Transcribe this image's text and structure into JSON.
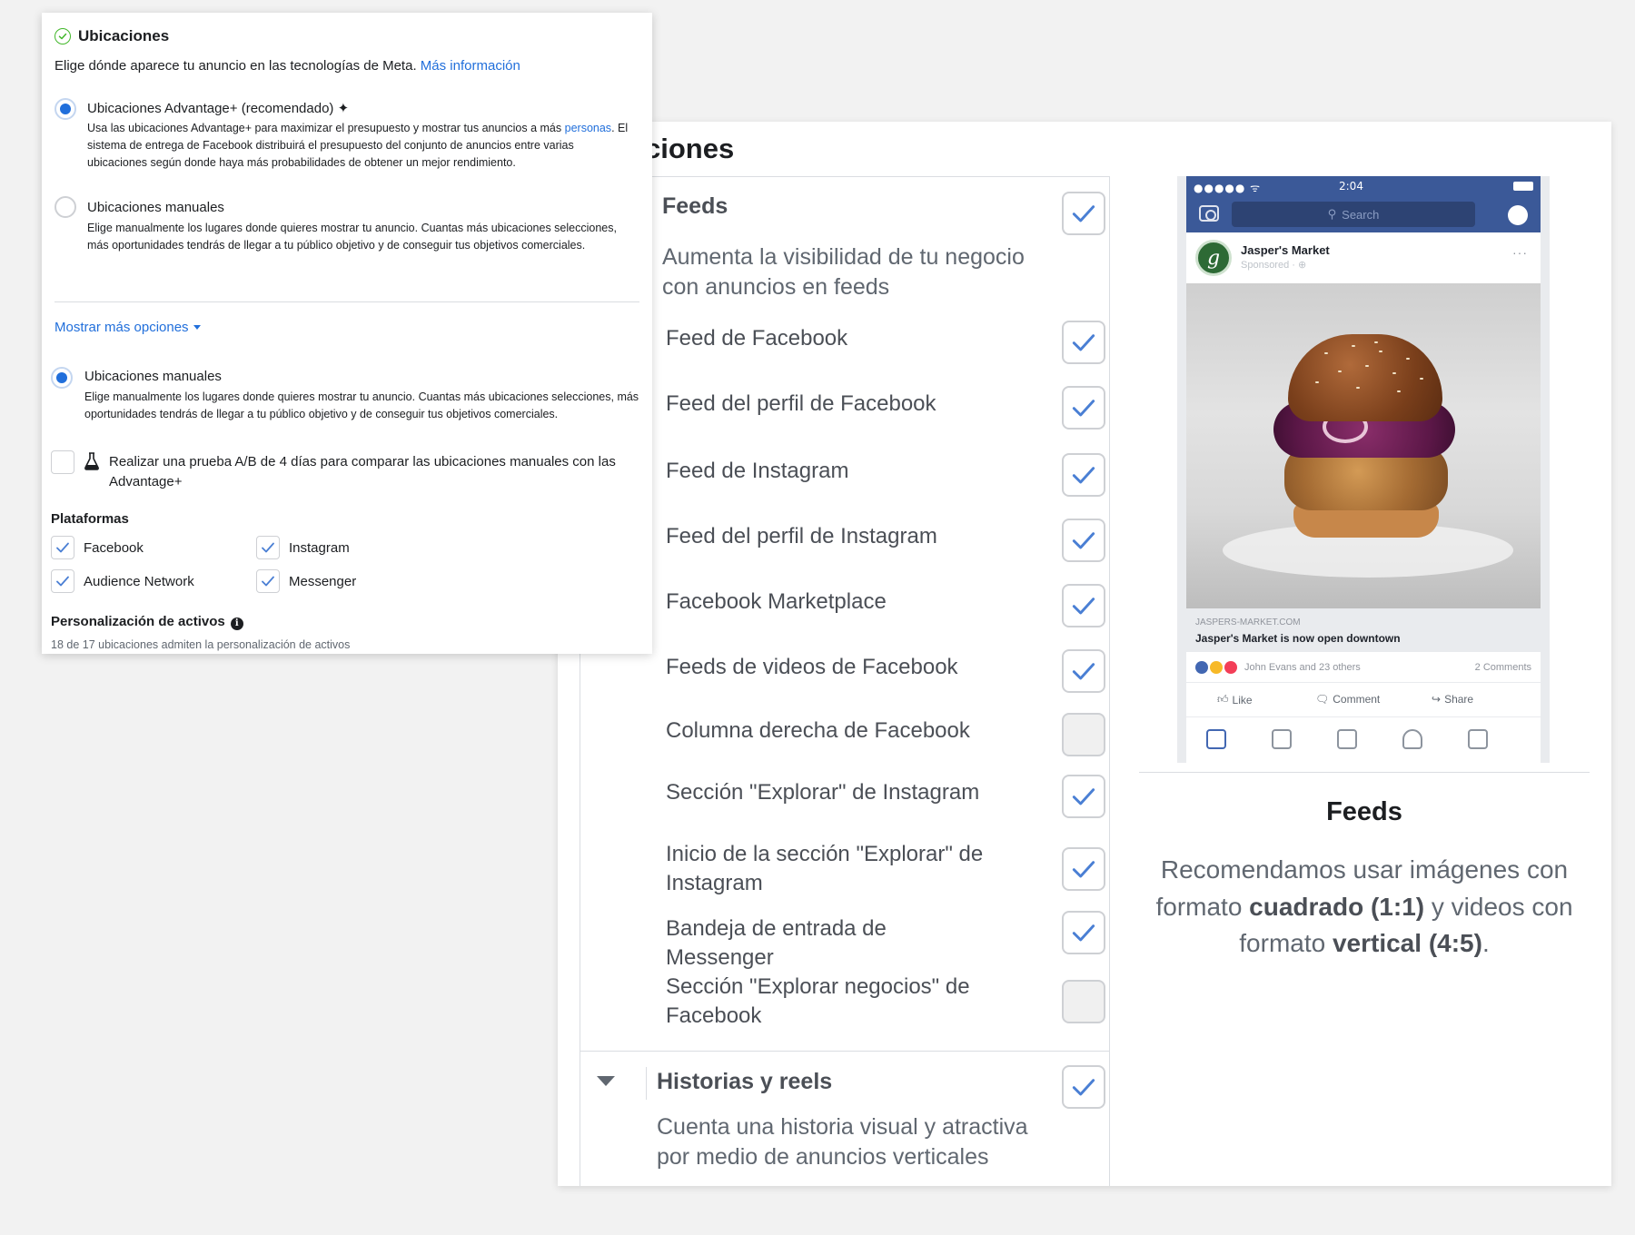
{
  "card": {
    "title": "Ubicaciones",
    "subtitle": "Elige dónde aparece tu anuncio en las tecnologías de Meta.",
    "subtitle_link": "Más información",
    "option_advantage": {
      "title": "Ubicaciones Advantage+ (recomendado)",
      "sparkle": "✦",
      "desc_pre": "Usa las ubicaciones Advantage+ para maximizar el presupuesto y mostrar tus anuncios a más",
      "desc_link": "personas",
      "desc_post": ". El sistema de entrega de Facebook distribuirá el presupuesto del conjunto de anuncios entre varias ubicaciones según donde haya más probabilidades de obtener un mejor rendimiento."
    },
    "option_manual": {
      "title": "Ubicaciones manuales",
      "desc": "Elige manualmente los lugares donde quieres mostrar tu anuncio. Cuantas más ubicaciones selecciones, más oportunidades tendrás de llegar a tu público objetivo y de conseguir tus objetivos comerciales."
    },
    "show_more": "Mostrar más opciones",
    "option_manual_selected": {
      "title": "Ubicaciones manuales",
      "desc": "Elige manualmente los lugares donde quieres mostrar tu anuncio. Cuantas más ubicaciones selecciones, más oportunidades tendrás de llegar a tu público objetivo y de conseguir tus objetivos comerciales."
    },
    "ab_test": "Realizar una prueba A/B de 4 días para comparar las ubicaciones manuales con las Advantage+",
    "platforms_title": "Plataformas",
    "platforms": [
      "Facebook",
      "Instagram",
      "Audience Network",
      "Messenger"
    ],
    "asset_title": "Personalización de activos",
    "asset_info": "i",
    "asset_note": "18 de 17 ubicaciones admiten la personalización de activos"
  },
  "bg": {
    "title": "ciones",
    "feeds": {
      "name": "Feeds",
      "desc": "Aumenta la visibilidad de tu negocio con anuncios en feeds",
      "checked": true
    },
    "items": [
      {
        "label": "Feed de Facebook",
        "checked": true
      },
      {
        "label": "Feed del perfil de Facebook",
        "checked": true
      },
      {
        "label": "Feed de Instagram",
        "checked": true
      },
      {
        "label": "Feed del perfil de Instagram",
        "checked": true
      },
      {
        "label": "Facebook Marketplace",
        "checked": true
      },
      {
        "label": "Feeds de videos de Facebook",
        "checked": true
      },
      {
        "label": "Columna derecha de Facebook",
        "checked": false
      },
      {
        "label": "Sección \"Explorar\" de Instagram",
        "checked": true
      },
      {
        "label": "Inicio de la sección \"Explorar\" de Instagram",
        "checked": true
      },
      {
        "label": "Bandeja de entrada de Messenger",
        "checked": true
      },
      {
        "label": "Sección \"Explorar negocios\" de Facebook",
        "checked": false
      }
    ],
    "stories": {
      "name": "Historias y reels",
      "desc": "Cuenta una historia visual y atractiva por medio de anuncios verticales",
      "checked": true
    },
    "phone": {
      "dots": "●●●●● ᯤ",
      "time": "2:04",
      "search": "Search",
      "page_name": "Jasper's Market",
      "avatar_letter": "g",
      "sponsored": "Sponsored · ⊕",
      "more": "···",
      "domain": "JASPERS-MARKET.COM",
      "headline": "Jasper's Market is now open downtown",
      "reactions": "John Evans and 23 others",
      "comments": "2 Comments",
      "like": "Like",
      "comment": "Comment",
      "share": "Share"
    },
    "right": {
      "title": "Feeds",
      "text_1": "Recomendamos usar imágenes con formato ",
      "bold_1": "cuadrado (1:1)",
      "text_2": " y videos con formato ",
      "bold_2": "vertical (4:5)",
      "text_3": "."
    }
  },
  "colors": {
    "accent_blue": "#216fdb",
    "check_blue": "#4a7fd4",
    "facebook_blue": "#3b5998",
    "success_green": "#42b72a"
  }
}
